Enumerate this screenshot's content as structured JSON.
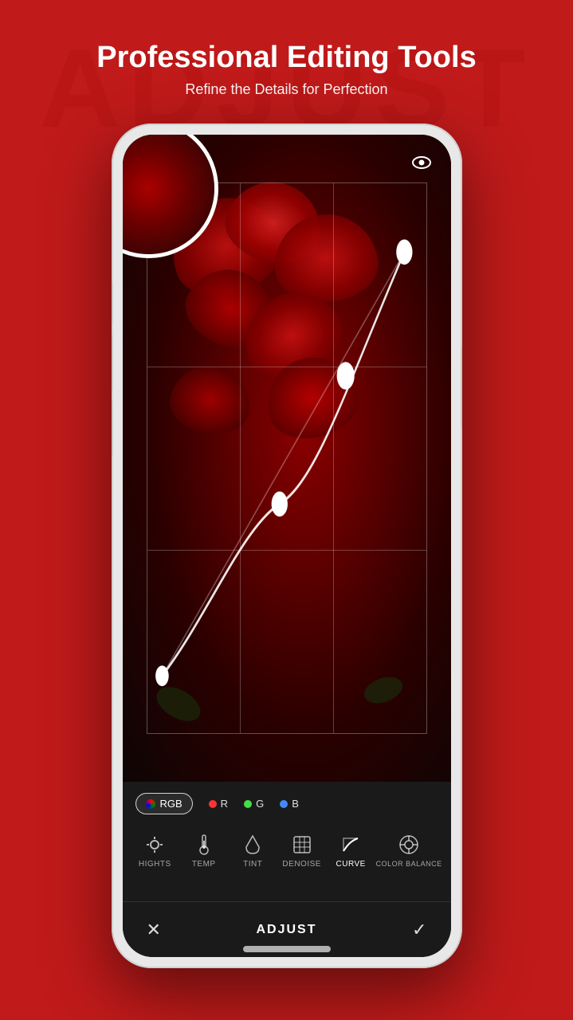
{
  "watermark": {
    "text": "ADJUST"
  },
  "header": {
    "title": "Professional Editing Tools",
    "subtitle": "Refine the Details for Perfection"
  },
  "phone": {
    "image_alt": "Red roses photo being edited"
  },
  "eye_icon": "👁",
  "rgb_channels": [
    {
      "id": "rgb",
      "label": "RGB",
      "dot_color": "conic-gradient(red, green, blue, red)",
      "active": true
    },
    {
      "id": "r",
      "label": "R",
      "dot_color": "#ff3333",
      "active": false
    },
    {
      "id": "g",
      "label": "G",
      "dot_color": "#33cc33",
      "active": false
    },
    {
      "id": "b",
      "label": "B",
      "dot_color": "#3366ff",
      "active": false
    }
  ],
  "tools": [
    {
      "id": "highlights",
      "label": "HIGHTS",
      "icon": "☀",
      "active": false
    },
    {
      "id": "temp",
      "label": "TEMP",
      "icon": "🌡",
      "active": false
    },
    {
      "id": "tint",
      "label": "TINT",
      "icon": "💧",
      "active": false
    },
    {
      "id": "denoise",
      "label": "DENOISE",
      "icon": "▦",
      "active": false
    },
    {
      "id": "curve",
      "label": "CURVE",
      "icon": "📈",
      "active": true
    },
    {
      "id": "colorbalance",
      "label": "COLOR BALANCE",
      "icon": "⚙",
      "active": false
    }
  ],
  "action_bar": {
    "cancel_icon": "✕",
    "title": "ADJUST",
    "confirm_icon": "✓"
  }
}
